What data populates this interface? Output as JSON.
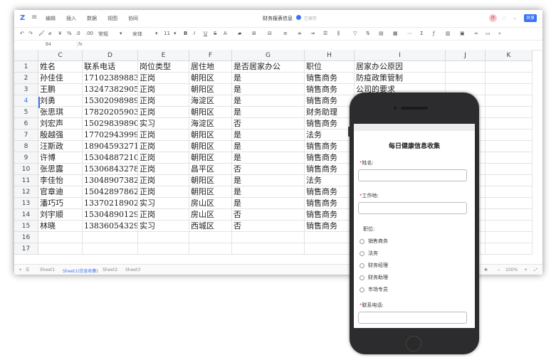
{
  "app": {
    "menus": [
      "编辑",
      "插入",
      "数据",
      "视图",
      "协同"
    ],
    "doc_title": "财务报表信息",
    "doc_subtitle": "已保存",
    "avatar_initial": "孙",
    "share_label": "共享"
  },
  "toolbar": {
    "font_name": "宋体",
    "font_size": "11",
    "format": "常规",
    "zoom": "100%"
  },
  "formula_bar": {
    "cell_ref": "B4",
    "fx": "fx"
  },
  "columns": [
    "C",
    "D",
    "E",
    "F",
    "G",
    "H",
    "I",
    "J",
    "K"
  ],
  "rows": [
    {
      "num": "1",
      "cells": [
        "姓名",
        "联系电话",
        "岗位类型",
        "居住地",
        "是否居家办公",
        "职位",
        "居家办公原因",
        "",
        ""
      ]
    },
    {
      "num": "2",
      "cells": [
        "孙佳佳",
        "17102389883",
        "正岗",
        "朝阳区",
        "是",
        "销售商务",
        "防疫政策管制",
        "",
        ""
      ]
    },
    {
      "num": "3",
      "cells": [
        "王鹏",
        "13247382905",
        "正岗",
        "朝阳区",
        "是",
        "销售商务",
        "公司的要求",
        "",
        ""
      ]
    },
    {
      "num": "4",
      "cells": [
        "刘勇",
        "15302098989",
        "正岗",
        "海淀区",
        "是",
        "销售商务",
        "",
        "",
        ""
      ]
    },
    {
      "num": "5",
      "cells": [
        "张思琪",
        "17820205903",
        "正岗",
        "朝阳区",
        "是",
        "财务助理",
        "",
        "",
        ""
      ]
    },
    {
      "num": "6",
      "cells": [
        "刘宏声",
        "15029839890",
        "实习",
        "海淀区",
        "否",
        "销售商务",
        "",
        "",
        ""
      ]
    },
    {
      "num": "7",
      "cells": [
        "殷越强",
        "17702943999",
        "正岗",
        "朝阳区",
        "是",
        "法务",
        "",
        "",
        ""
      ]
    },
    {
      "num": "8",
      "cells": [
        "汪斯政",
        "18904593271",
        "正岗",
        "朝阳区",
        "是",
        "销售商务",
        "",
        "",
        ""
      ]
    },
    {
      "num": "9",
      "cells": [
        "许博",
        "15304887210",
        "正岗",
        "朝阳区",
        "是",
        "销售商务",
        "",
        "",
        ""
      ]
    },
    {
      "num": "10",
      "cells": [
        "张思露",
        "15306843278",
        "正岗",
        "昌平区",
        "否",
        "销售商务",
        "",
        "",
        ""
      ]
    },
    {
      "num": "11",
      "cells": [
        "李佳怡",
        "13048907382",
        "正岗",
        "朝阳区",
        "是",
        "法务",
        "",
        "",
        ""
      ]
    },
    {
      "num": "12",
      "cells": [
        "官章迪",
        "15042897862",
        "正岗",
        "朝阳区",
        "是",
        "销售商务",
        "",
        "",
        ""
      ]
    },
    {
      "num": "13",
      "cells": [
        "潘巧巧",
        "13370218902",
        "实习",
        "房山区",
        "是",
        "销售商务",
        "",
        "",
        ""
      ]
    },
    {
      "num": "14",
      "cells": [
        "刘宇顺",
        "15304890129",
        "正岗",
        "房山区",
        "否",
        "销售商务",
        "",
        "",
        ""
      ]
    },
    {
      "num": "15",
      "cells": [
        "林晓",
        "13836054329",
        "实习",
        "西城区",
        "否",
        "销售商务",
        "",
        "",
        ""
      ]
    },
    {
      "num": "16",
      "cells": [
        "",
        "",
        "",
        "",
        "",
        "",
        "",
        "",
        ""
      ]
    },
    {
      "num": "17",
      "cells": [
        "",
        "",
        "",
        "",
        "",
        "",
        "",
        "",
        ""
      ]
    }
  ],
  "sheets": [
    "Sheet1",
    "Sheet1(信息收集)",
    "Sheet2",
    "Sheet3"
  ],
  "form": {
    "title": "每日健康信息收集",
    "required_mark": "*",
    "name_label": "姓名:",
    "workplace_label": "工作地:",
    "position_label": "职位:",
    "position_options": [
      "销售商务",
      "法务",
      "财务经理",
      "财务助理",
      "市场专员"
    ],
    "phone_label": "联系电话:"
  },
  "colors": {
    "accent": "#3b74f2",
    "required": "#e53935"
  }
}
